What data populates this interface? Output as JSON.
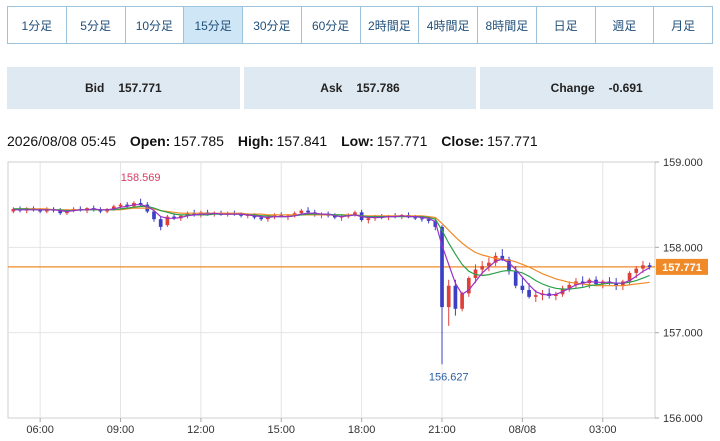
{
  "timeframes": [
    {
      "label": "1分足",
      "active": false
    },
    {
      "label": "5分足",
      "active": false
    },
    {
      "label": "10分足",
      "active": false
    },
    {
      "label": "15分足",
      "active": true
    },
    {
      "label": "30分足",
      "active": false
    },
    {
      "label": "60分足",
      "active": false
    },
    {
      "label": "2時間足",
      "active": false
    },
    {
      "label": "4時間足",
      "active": false
    },
    {
      "label": "8時間足",
      "active": false
    },
    {
      "label": "日足",
      "active": false
    },
    {
      "label": "週足",
      "active": false
    },
    {
      "label": "月足",
      "active": false
    }
  ],
  "quotes": {
    "bid": {
      "label": "Bid",
      "value": "157.771"
    },
    "ask": {
      "label": "Ask",
      "value": "157.786"
    },
    "change": {
      "label": "Change",
      "value": "-0.691"
    }
  },
  "ohlc": {
    "datetime": "2026/08/08 05:45",
    "open_label": "Open:",
    "open": "157.785",
    "high_label": "High:",
    "high": "157.841",
    "low_label": "Low:",
    "low": "157.771",
    "close_label": "Close:",
    "close": "157.771"
  },
  "colors": {
    "up": "#e0403a",
    "down": "#3b3fc4",
    "ma_short": "#9b30c8",
    "ma_mid": "#2aa04a",
    "ma_long": "#f08a28",
    "price_line": "#f08a28",
    "grid": "#e4e4e4",
    "tab_active_bg": "#cfe6f6"
  },
  "chart_data": {
    "type": "candlestick",
    "ylim": [
      156.0,
      159.0
    ],
    "y_ticks": [
      "159.000",
      "158.000",
      "157.000",
      "156.000"
    ],
    "x_ticks": [
      {
        "label": "06:00",
        "x": 4
      },
      {
        "label": "09:00",
        "x": 16
      },
      {
        "label": "12:00",
        "x": 28
      },
      {
        "label": "15:00",
        "x": 40
      },
      {
        "label": "18:00",
        "x": 52
      },
      {
        "label": "21:00",
        "x": 64
      },
      {
        "label": "08/08",
        "x": 76
      },
      {
        "label": "03:00",
        "x": 88
      }
    ],
    "current_price": 157.771,
    "current_price_label": "157.771",
    "annotations": [
      {
        "text": "158.569",
        "x": 19,
        "value": 158.569,
        "position": "above"
      },
      {
        "text": "156.627",
        "x": 65,
        "value": 156.627,
        "position": "below"
      }
    ],
    "ohlc": [
      [
        158.42,
        158.47,
        158.4,
        158.45
      ],
      [
        158.45,
        158.48,
        158.41,
        158.43
      ],
      [
        158.43,
        158.47,
        158.4,
        158.46
      ],
      [
        158.46,
        158.48,
        158.42,
        158.44
      ],
      [
        158.44,
        158.46,
        158.4,
        158.42
      ],
      [
        158.42,
        158.47,
        158.4,
        158.45
      ],
      [
        158.45,
        158.47,
        158.41,
        158.43
      ],
      [
        158.43,
        158.46,
        158.38,
        158.4
      ],
      [
        158.4,
        158.45,
        158.38,
        158.44
      ],
      [
        158.44,
        158.47,
        158.41,
        158.45
      ],
      [
        158.45,
        158.48,
        158.42,
        158.43
      ],
      [
        158.43,
        158.47,
        158.4,
        158.46
      ],
      [
        158.46,
        158.49,
        158.42,
        158.44
      ],
      [
        158.44,
        158.47,
        158.4,
        158.42
      ],
      [
        158.42,
        158.46,
        158.4,
        158.45
      ],
      [
        158.45,
        158.5,
        158.43,
        158.48
      ],
      [
        158.48,
        158.52,
        158.45,
        158.5
      ],
      [
        158.5,
        158.53,
        158.46,
        158.48
      ],
      [
        158.48,
        158.54,
        158.46,
        158.52
      ],
      [
        158.52,
        158.57,
        158.48,
        158.5
      ],
      [
        158.5,
        158.53,
        158.4,
        158.42
      ],
      [
        158.42,
        158.44,
        158.3,
        158.33
      ],
      [
        158.33,
        158.36,
        158.2,
        158.24
      ],
      [
        158.26,
        158.38,
        158.24,
        158.36
      ],
      [
        158.36,
        158.4,
        158.32,
        158.34
      ],
      [
        158.34,
        158.38,
        158.31,
        158.37
      ],
      [
        158.37,
        158.42,
        158.34,
        158.4
      ],
      [
        158.4,
        158.44,
        158.36,
        158.38
      ],
      [
        158.38,
        158.43,
        158.35,
        158.41
      ],
      [
        158.41,
        158.44,
        158.37,
        158.39
      ],
      [
        158.39,
        158.42,
        158.36,
        158.4
      ],
      [
        158.4,
        158.43,
        158.37,
        158.38
      ],
      [
        158.38,
        158.42,
        158.36,
        158.4
      ],
      [
        158.4,
        158.43,
        158.37,
        158.39
      ],
      [
        158.39,
        158.41,
        158.35,
        158.37
      ],
      [
        158.37,
        158.4,
        158.34,
        158.38
      ],
      [
        158.38,
        158.4,
        158.33,
        158.35
      ],
      [
        158.35,
        158.38,
        158.31,
        158.33
      ],
      [
        158.33,
        158.37,
        158.3,
        158.36
      ],
      [
        158.36,
        158.4,
        158.33,
        158.38
      ],
      [
        158.38,
        158.41,
        158.35,
        158.36
      ],
      [
        158.36,
        158.39,
        158.32,
        158.37
      ],
      [
        158.37,
        158.42,
        158.35,
        158.4
      ],
      [
        158.4,
        158.45,
        158.38,
        158.43
      ],
      [
        158.43,
        158.47,
        158.39,
        158.41
      ],
      [
        158.41,
        158.44,
        158.36,
        158.38
      ],
      [
        158.38,
        158.41,
        158.34,
        158.39
      ],
      [
        158.39,
        158.42,
        158.35,
        158.37
      ],
      [
        158.37,
        158.4,
        158.33,
        158.35
      ],
      [
        158.35,
        158.38,
        158.31,
        158.36
      ],
      [
        158.36,
        158.4,
        158.34,
        158.38
      ],
      [
        158.38,
        158.43,
        158.36,
        158.41
      ],
      [
        158.41,
        158.44,
        158.3,
        158.32
      ],
      [
        158.32,
        158.36,
        158.28,
        158.34
      ],
      [
        158.34,
        158.38,
        158.31,
        158.36
      ],
      [
        158.36,
        158.39,
        158.33,
        158.35
      ],
      [
        158.35,
        158.38,
        158.32,
        158.37
      ],
      [
        158.37,
        158.4,
        158.34,
        158.36
      ],
      [
        158.36,
        158.39,
        158.33,
        158.38
      ],
      [
        158.38,
        158.41,
        158.34,
        158.35
      ],
      [
        158.35,
        158.38,
        158.32,
        158.34
      ],
      [
        158.34,
        158.37,
        158.3,
        158.33
      ],
      [
        158.33,
        158.36,
        158.28,
        158.31
      ],
      [
        158.31,
        158.34,
        158.2,
        158.24
      ],
      [
        158.24,
        158.26,
        156.63,
        157.3
      ],
      [
        157.3,
        157.62,
        157.08,
        157.55
      ],
      [
        157.55,
        157.62,
        157.2,
        157.28
      ],
      [
        157.28,
        157.48,
        157.25,
        157.46
      ],
      [
        157.46,
        157.66,
        157.42,
        157.64
      ],
      [
        157.64,
        157.8,
        157.58,
        157.74
      ],
      [
        157.74,
        157.84,
        157.68,
        157.78
      ],
      [
        157.78,
        157.88,
        157.72,
        157.82
      ],
      [
        157.82,
        157.94,
        157.78,
        157.9
      ],
      [
        157.9,
        157.98,
        157.84,
        157.86
      ],
      [
        157.86,
        157.89,
        157.68,
        157.72
      ],
      [
        157.72,
        157.78,
        157.52,
        157.55
      ],
      [
        157.55,
        157.64,
        157.46,
        157.5
      ],
      [
        157.5,
        157.58,
        157.4,
        157.42
      ],
      [
        157.42,
        157.5,
        157.36,
        157.44
      ],
      [
        157.44,
        157.5,
        157.38,
        157.46
      ],
      [
        157.46,
        157.52,
        157.4,
        157.43
      ],
      [
        157.43,
        157.48,
        157.38,
        157.45
      ],
      [
        157.45,
        157.55,
        157.42,
        157.52
      ],
      [
        157.52,
        157.6,
        157.48,
        157.56
      ],
      [
        157.56,
        157.64,
        157.52,
        157.6
      ],
      [
        157.6,
        157.66,
        157.54,
        157.58
      ],
      [
        157.58,
        157.64,
        157.52,
        157.62
      ],
      [
        157.62,
        157.66,
        157.55,
        157.57
      ],
      [
        157.57,
        157.62,
        157.52,
        157.6
      ],
      [
        157.6,
        157.65,
        157.56,
        157.58
      ],
      [
        157.58,
        157.64,
        157.5,
        157.55
      ],
      [
        157.55,
        157.62,
        157.5,
        157.6
      ],
      [
        157.6,
        157.72,
        157.56,
        157.7
      ],
      [
        157.7,
        157.78,
        157.64,
        157.75
      ],
      [
        157.75,
        157.84,
        157.7,
        157.79
      ],
      [
        157.79,
        157.82,
        157.74,
        157.77
      ]
    ],
    "ma_short": [
      158.44,
      158.44,
      158.44,
      158.44,
      158.44,
      158.44,
      158.44,
      158.43,
      158.42,
      158.43,
      158.44,
      158.44,
      158.45,
      158.44,
      158.44,
      158.45,
      158.47,
      158.48,
      158.5,
      158.5,
      158.48,
      158.43,
      158.36,
      158.34,
      158.34,
      158.35,
      158.37,
      158.38,
      158.39,
      158.39,
      158.4,
      158.39,
      158.39,
      158.39,
      158.39,
      158.38,
      158.37,
      158.36,
      158.35,
      158.36,
      158.36,
      158.36,
      158.37,
      158.39,
      158.4,
      158.4,
      158.39,
      158.39,
      158.37,
      158.36,
      158.37,
      158.38,
      158.36,
      158.35,
      158.35,
      158.35,
      158.36,
      158.36,
      158.37,
      158.36,
      158.36,
      158.35,
      158.34,
      158.3,
      158.02,
      157.8,
      157.58,
      157.45,
      157.5,
      157.6,
      157.7,
      157.77,
      157.84,
      157.86,
      157.82,
      157.74,
      157.65,
      157.56,
      157.48,
      157.45,
      157.44,
      157.45,
      157.48,
      157.52,
      157.56,
      157.58,
      157.6,
      157.59,
      157.59,
      157.59,
      157.58,
      157.58,
      157.61,
      157.66,
      157.72,
      157.76
    ],
    "ma_mid": [
      158.45,
      158.45,
      158.45,
      158.44,
      158.44,
      158.44,
      158.44,
      158.44,
      158.43,
      158.43,
      158.44,
      158.44,
      158.44,
      158.44,
      158.44,
      158.44,
      158.45,
      158.46,
      158.47,
      158.48,
      158.48,
      158.46,
      158.43,
      158.41,
      158.39,
      158.38,
      158.38,
      158.38,
      158.38,
      158.38,
      158.39,
      158.39,
      158.39,
      158.39,
      158.39,
      158.38,
      158.38,
      158.37,
      158.37,
      158.36,
      158.36,
      158.36,
      158.37,
      158.38,
      158.39,
      158.39,
      158.39,
      158.39,
      158.38,
      158.38,
      158.37,
      158.38,
      158.37,
      158.36,
      158.36,
      158.36,
      158.36,
      158.36,
      158.36,
      158.36,
      158.36,
      158.36,
      158.35,
      158.33,
      158.2,
      158.05,
      157.92,
      157.8,
      157.72,
      157.68,
      157.67,
      157.68,
      157.7,
      157.72,
      157.73,
      157.72,
      157.7,
      157.66,
      157.61,
      157.57,
      157.54,
      157.52,
      157.51,
      157.51,
      157.52,
      157.53,
      157.55,
      157.56,
      157.57,
      157.58,
      157.58,
      157.58,
      157.59,
      157.61,
      157.64,
      157.67
    ],
    "ma_long": [
      158.45,
      158.45,
      158.45,
      158.45,
      158.45,
      158.45,
      158.44,
      158.44,
      158.44,
      158.44,
      158.44,
      158.44,
      158.44,
      158.44,
      158.44,
      158.44,
      158.44,
      158.45,
      158.46,
      158.46,
      158.46,
      158.45,
      158.43,
      158.42,
      158.41,
      158.4,
      158.4,
      158.4,
      158.4,
      158.4,
      158.4,
      158.4,
      158.4,
      158.4,
      158.4,
      158.39,
      158.39,
      158.39,
      158.38,
      158.38,
      158.38,
      158.38,
      158.38,
      158.38,
      158.38,
      158.38,
      158.38,
      158.38,
      158.38,
      158.38,
      158.38,
      158.38,
      158.37,
      158.37,
      158.37,
      158.37,
      158.37,
      158.37,
      158.37,
      158.37,
      158.37,
      158.37,
      158.36,
      158.35,
      158.28,
      158.2,
      158.12,
      158.05,
      157.99,
      157.94,
      157.91,
      157.89,
      157.87,
      157.86,
      157.85,
      157.83,
      157.8,
      157.77,
      157.73,
      157.69,
      157.66,
      157.63,
      157.61,
      157.59,
      157.58,
      157.57,
      157.56,
      157.55,
      157.55,
      157.55,
      157.55,
      157.55,
      157.56,
      157.57,
      157.58,
      157.59
    ]
  }
}
